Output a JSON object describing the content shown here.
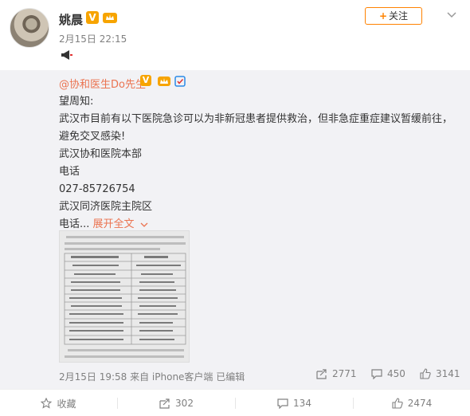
{
  "user": {
    "name": "姚晨",
    "vip_badge": "V",
    "time": "2月15日 22:15",
    "follow_label": "关注"
  },
  "repost": {
    "author": "@协和医生Do先生",
    "badge": "V",
    "lines": [
      "望周知:",
      "武汉市目前有以下医院急诊可以为非新冠患者提供救治，但非急症重症建议暂缓前往，避免交叉感染!",
      "武汉协和医院本部",
      "电话",
      "027-85726754",
      "武汉同济医院主院区"
    ],
    "last_line": "电话...",
    "expand_label": "展开全文",
    "meta": "2月15日 19:58 来自 iPhone客户端  已编辑",
    "reposts": "2771",
    "comments": "450",
    "likes": "3141"
  },
  "footer": {
    "collect": "收藏",
    "repost": "302",
    "comment": "134",
    "like": "2474"
  },
  "colors": {
    "accent": "#eb7350",
    "follow_border": "#ff8200",
    "repost_bg": "#f2f2f5",
    "meta_gray": "#808080"
  }
}
